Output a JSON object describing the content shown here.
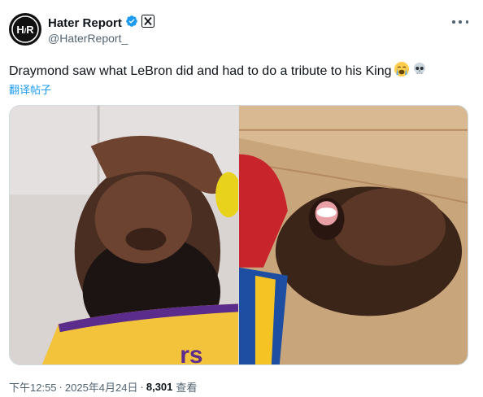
{
  "author": {
    "name": "Hater Report",
    "handle": "@HaterReport_",
    "avatar_text": "H R",
    "verified": true,
    "affiliate_badge_icon": "x-logo-icon"
  },
  "tweet": {
    "text": "Draymond saw what LeBron did and had to do a tribute to his King",
    "emojis": [
      "loudly-crying-face",
      "skull"
    ],
    "translate_label": "翻译帖子"
  },
  "media": {
    "left_photo": "lebron-hand-on-face",
    "right_photo": "draymond-lying-on-floor"
  },
  "footer": {
    "time": "下午12:55",
    "separator": "·",
    "date": "2025年4月24日",
    "views_count": "8,301",
    "views_label": "查看"
  },
  "colors": {
    "accent": "#1d9bf0",
    "secondary_text": "#536471",
    "primary_text": "#0f1419"
  }
}
